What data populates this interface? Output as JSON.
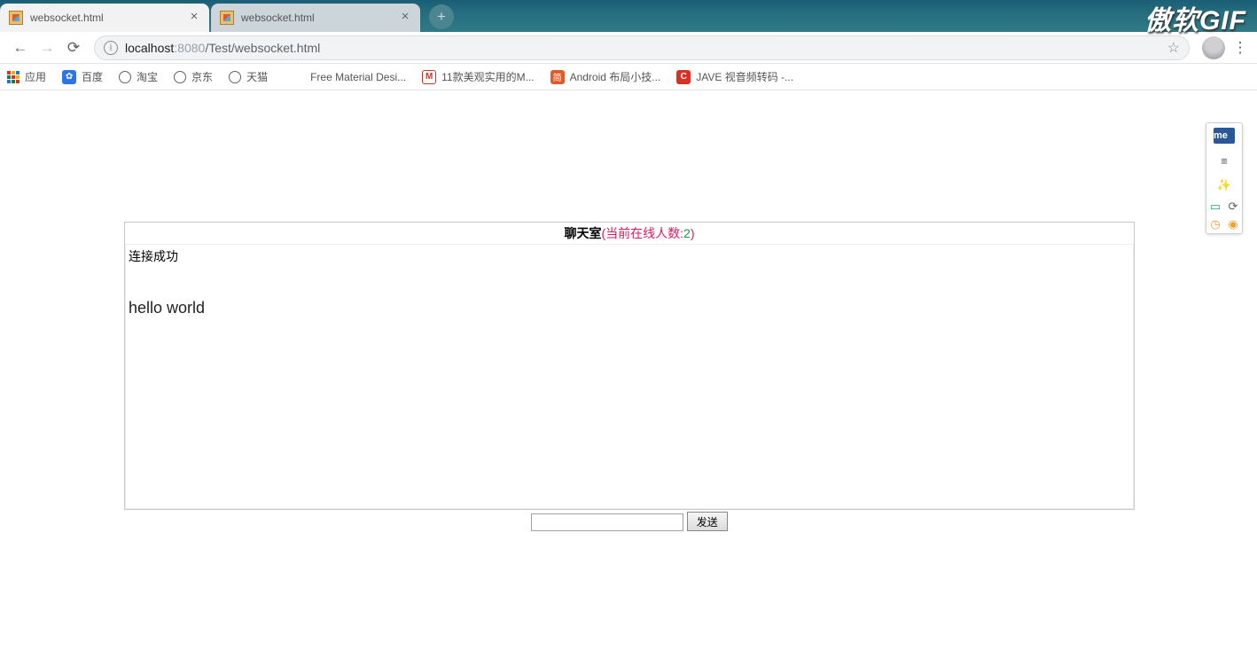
{
  "tabs": [
    {
      "title": "websocket.html",
      "active": true
    },
    {
      "title": "websocket.html",
      "active": false
    }
  ],
  "address": {
    "host": "localhost",
    "port": ":8080",
    "path": "/Test/websocket.html"
  },
  "bookmarks": {
    "apps": "应用",
    "items": [
      {
        "label": "百度",
        "iconClass": "ic-baidu",
        "glyph": "✿"
      },
      {
        "label": "淘宝",
        "iconClass": "ic-globe",
        "glyph": ""
      },
      {
        "label": "京东",
        "iconClass": "ic-globe",
        "glyph": ""
      },
      {
        "label": "天猫",
        "iconClass": "ic-globe",
        "glyph": ""
      },
      {
        "label": "Free Material Desi...",
        "iconClass": "",
        "glyph": ""
      },
      {
        "label": "11款美观实用的M...",
        "iconClass": "ic-gmail",
        "glyph": "M"
      },
      {
        "label": "Android 布局小技...",
        "iconClass": "ic-jian",
        "glyph": "简"
      },
      {
        "label": "JAVE 视音频转码 -...",
        "iconClass": "ic-c",
        "glyph": "C"
      }
    ]
  },
  "chat": {
    "roomLabel": "聊天室",
    "onlineLabel": "当前在线人数:",
    "onlineCount": "2",
    "messages": {
      "sys": "连接成功",
      "msg1": "hello world"
    },
    "sendLabel": "发送",
    "inputValue": ""
  },
  "watermark": "傲软GIF",
  "sidepanel": {
    "me": "me"
  }
}
